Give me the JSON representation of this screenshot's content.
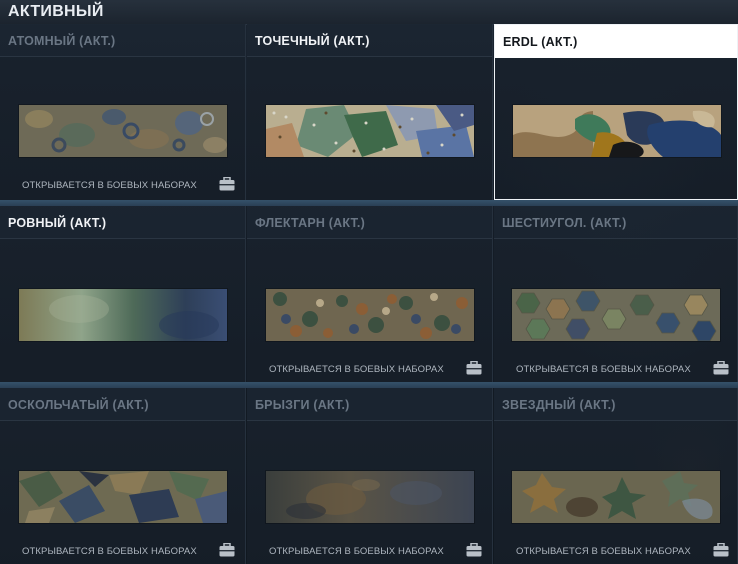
{
  "header": {
    "title": "АКТИВНЫЙ"
  },
  "tiles": [
    {
      "name": "АТОМНЫЙ (АКТ.)",
      "unlock_text": "ОТКРЫВАЕТСЯ В БОЕВЫХ НАБОРАХ"
    },
    {
      "name": "ТОЧЕЧНЫЙ (АКТ.)",
      "unlock_text": ""
    },
    {
      "name": "ERDL (АКТ.)",
      "unlock_text": ""
    },
    {
      "name": "РОВНЫЙ (АКТ.)",
      "unlock_text": ""
    },
    {
      "name": "ФЛЕКТАРН (АКТ.)",
      "unlock_text": "ОТКРЫВАЕТСЯ В БОЕВЫХ НАБОРАХ"
    },
    {
      "name": "ШЕСТИУГОЛ. (АКТ.)",
      "unlock_text": "ОТКРЫВАЕТСЯ В БОЕВЫХ НАБОРАХ"
    },
    {
      "name": "ОСКОЛЬЧАТЫЙ (АКТ.)",
      "unlock_text": "ОТКРЫВАЕТСЯ В БОЕВЫХ НАБОРАХ"
    },
    {
      "name": "БРЫЗГИ (АКТ.)",
      "unlock_text": "ОТКРЫВАЕТСЯ В БОЕВЫХ НАБОРАХ"
    },
    {
      "name": "ЗВЕЗДНЫЙ (АКТ.)",
      "unlock_text": "ОТКРЫВАЕТСЯ В БОЕВЫХ НАБОРАХ"
    }
  ],
  "colors": {
    "accent_separator": "#35516a",
    "selected_header": "#ffffff"
  },
  "icons": {
    "unlock_icon": "case-icon"
  }
}
